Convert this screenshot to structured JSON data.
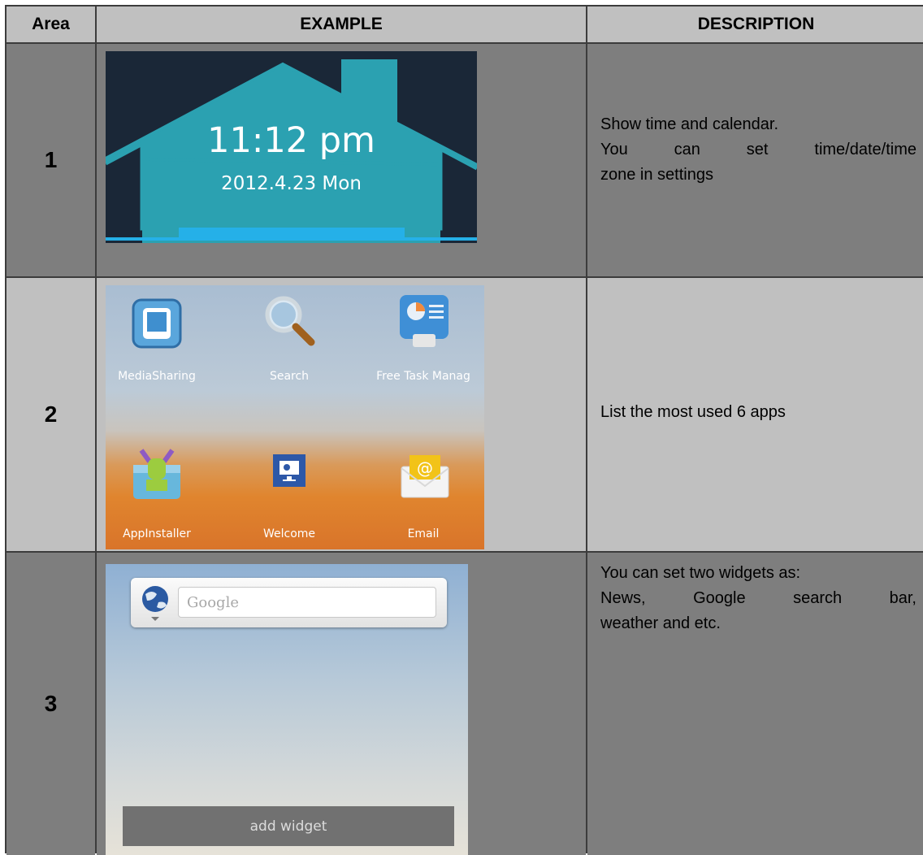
{
  "headers": {
    "area": "Area",
    "example": "EXAMPLE",
    "description": "DESCRIPTION"
  },
  "rows": [
    {
      "area": "1",
      "desc_lines": [
        "Show time and calendar.",
        "You can set time/date/time",
        "zone in settings"
      ],
      "example": {
        "time": "11:12 pm",
        "date": "2012.4.23  Mon"
      }
    },
    {
      "area": "2",
      "desc_lines": [
        "List the most used 6 apps"
      ],
      "example": {
        "apps": [
          {
            "label": "MediaSharing",
            "icon": "media-sharing-icon"
          },
          {
            "label": "Search",
            "icon": "magnifier-icon"
          },
          {
            "label": "Free Task Manag",
            "icon": "task-manager-icon"
          },
          {
            "label": "AppInstaller",
            "icon": "app-installer-icon"
          },
          {
            "label": "Welcome",
            "icon": "welcome-icon"
          },
          {
            "label": "Email",
            "icon": "email-icon"
          }
        ]
      }
    },
    {
      "area": "3",
      "desc_lines": [
        "You can set two widgets as:",
        "News, Google search bar,",
        "weather and etc."
      ],
      "example": {
        "search_placeholder": "Google",
        "add_widget": "add widget"
      }
    }
  ],
  "colors": {
    "header_bg": "#c0c0c0",
    "row_bg": "#7e7e7e",
    "border": "#3c3c3c",
    "clock_accent": "#2aa3b0"
  }
}
